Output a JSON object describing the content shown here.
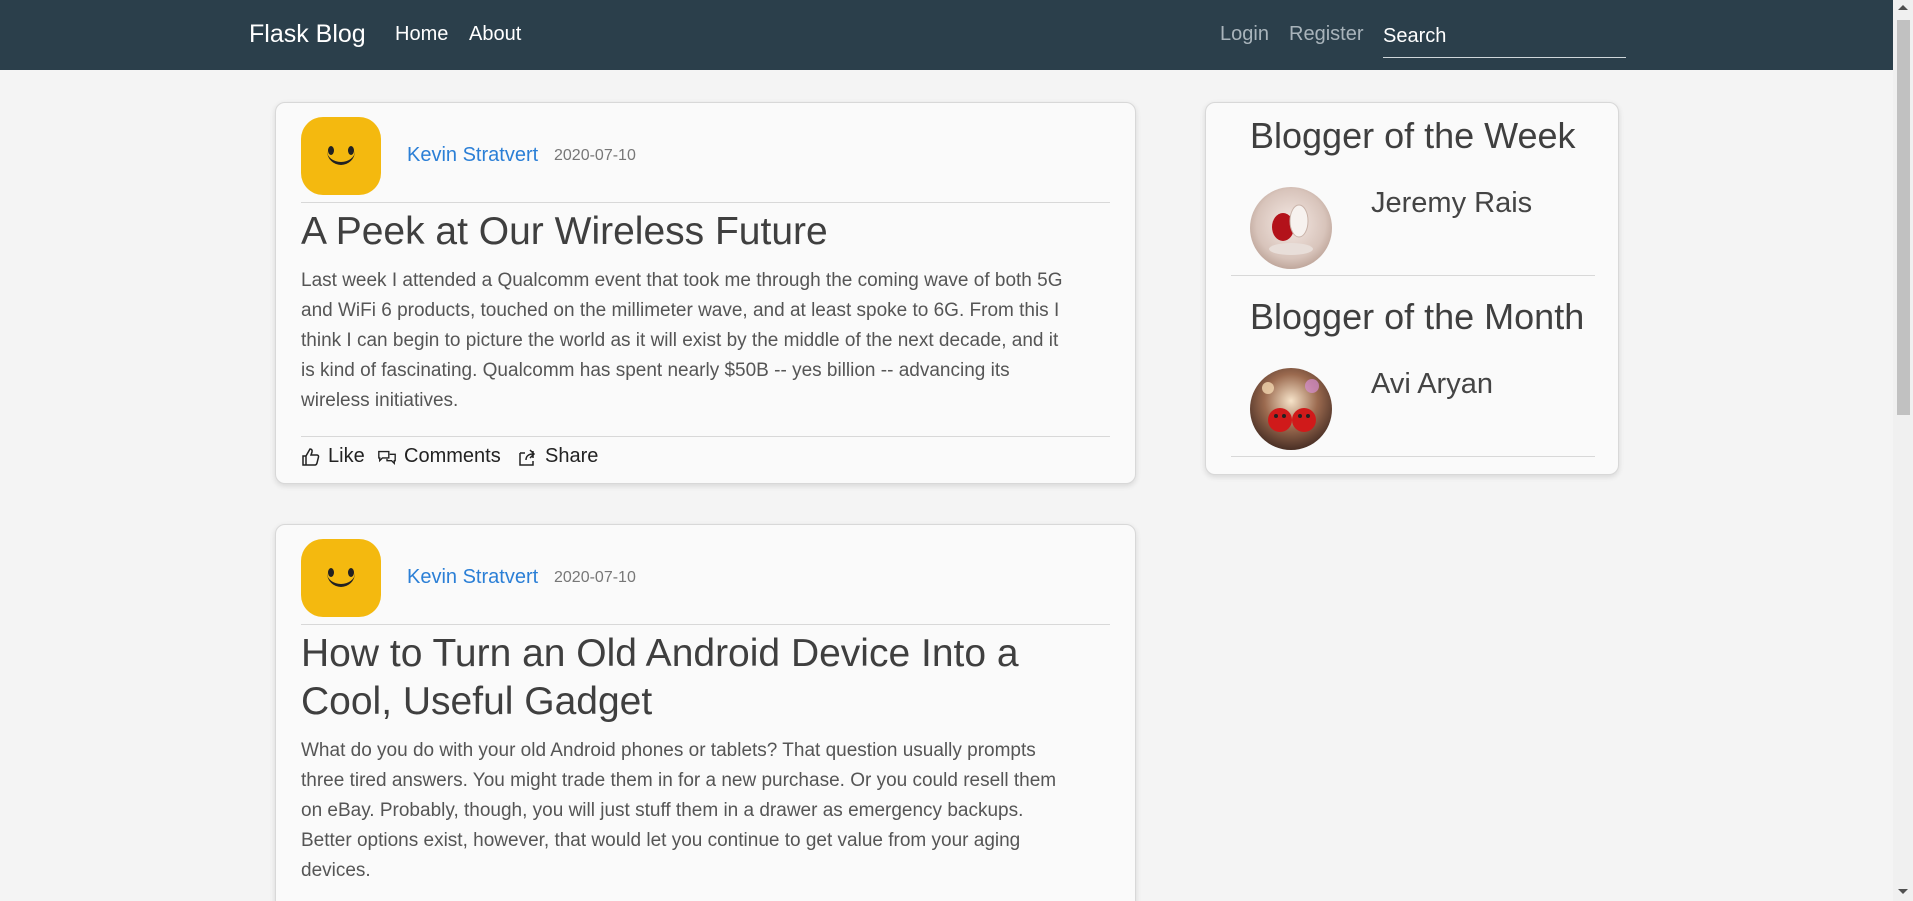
{
  "nav": {
    "brand": "Flask Blog",
    "links": [
      {
        "label": "Home"
      },
      {
        "label": "About"
      }
    ],
    "auth": [
      {
        "label": "Login"
      },
      {
        "label": "Register"
      }
    ],
    "search_placeholder": "Search"
  },
  "posts": [
    {
      "author": "Kevin Stratvert",
      "date": "2020-07-10",
      "title": "A Peek at Our Wireless Future",
      "body_lines": [
        "Last week I attended a Qualcomm event that took me through the coming wave of both 5G",
        "and WiFi 6 products, touched on the millimeter wave, and at least spoke to 6G. From this I",
        "think I can begin to picture the world as it will exist by the middle of the next decade, and it",
        "is kind of fascinating. Qualcomm has spent nearly $50B -- yes billion -- advancing its",
        "wireless initiatives."
      ],
      "actions": {
        "like": "Like",
        "comments": "Comments",
        "share": "Share"
      }
    },
    {
      "author": "Kevin Stratvert",
      "date": "2020-07-10",
      "title_lines": [
        "How to Turn an Old Android Device Into a",
        "Cool, Useful Gadget"
      ],
      "body_lines": [
        "What do you do with your old Android phones or tablets? That question usually prompts",
        "three tired answers. You might trade them in for a new purchase. Or you could resell them",
        "on eBay. Probably, though, you will just stuff them in a drawer as emergency backups.",
        "Better options exist, however, that would let you continue to get value from your aging",
        "devices."
      ]
    }
  ],
  "sidebar": {
    "week": {
      "heading": "Blogger of the Week",
      "name": "Jeremy Rais"
    },
    "month": {
      "heading": "Blogger of the Month",
      "name": "Avi Aryan"
    }
  },
  "colors": {
    "navbar": "#2b3f4b",
    "author_link": "#2b7fd6",
    "avatar": "#f4b90f"
  },
  "icons": [
    "thumbs-up-icon",
    "comments-icon",
    "share-icon"
  ]
}
